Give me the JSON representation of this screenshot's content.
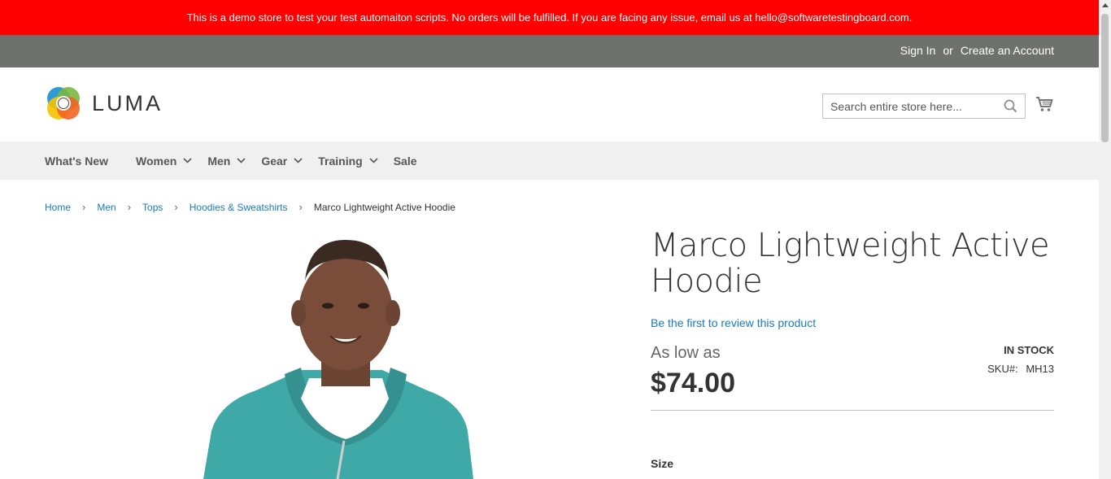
{
  "banner": {
    "text": "This is a demo store to test your test automaiton scripts. No orders will be fulfilled. If you are facing any issue, email us at hello@softwaretestingboard.com."
  },
  "topbar": {
    "sign_in": "Sign In",
    "or": "or",
    "create_account": "Create an Account"
  },
  "header": {
    "logo_text": "LUMA",
    "search_placeholder": "Search entire store here...",
    "cart_icon": "cart-icon",
    "search_icon": "search-icon"
  },
  "nav": {
    "items": [
      {
        "label": "What's New",
        "has_dropdown": false
      },
      {
        "label": "Women",
        "has_dropdown": true
      },
      {
        "label": "Men",
        "has_dropdown": true
      },
      {
        "label": "Gear",
        "has_dropdown": true
      },
      {
        "label": "Training",
        "has_dropdown": true
      },
      {
        "label": "Sale",
        "has_dropdown": false
      }
    ]
  },
  "breadcrumbs": {
    "items": [
      "Home",
      "Men",
      "Tops",
      "Hoodies & Sweatshirts"
    ],
    "current": "Marco Lightweight Active Hoodie"
  },
  "product": {
    "title_line1": "Marco Lightweight Active",
    "title_line2": "Hoodie",
    "review_link": "Be the first to review this product",
    "price_prefix": "As low as",
    "price": "$74.00",
    "stock": "In stock",
    "sku_label": "SKU#:",
    "sku_value": "MH13",
    "size_label": "Size"
  },
  "colors": {
    "banner": "#ff0000",
    "topbar": "#6e716e",
    "nav_bg": "#f0f0f0",
    "link": "#1979c3",
    "hoodie": "#3fa9a8"
  }
}
